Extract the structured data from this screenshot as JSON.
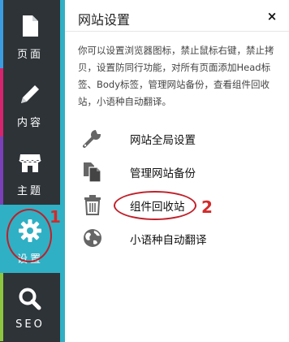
{
  "sidebar": {
    "items": [
      {
        "label": "页面",
        "icon": "page-icon",
        "accent": "#3b9de0"
      },
      {
        "label": "内容",
        "icon": "pencil-icon",
        "accent": "#d6246e"
      },
      {
        "label": "主题",
        "icon": "store-icon",
        "accent": "#7b3fb8"
      },
      {
        "label": "设置",
        "icon": "gear-icon",
        "accent": "#2fb0c4",
        "active": true
      },
      {
        "label": "SEO",
        "icon": "search-icon",
        "accent": "#8cc63f"
      }
    ]
  },
  "panel": {
    "title": "网站设置",
    "close_label": "×",
    "description": "你可以设置浏览器图标，禁止鼠标右键，禁止拷贝，设置防同行功能，对所有页面添加Head标签、Body标签，管理网站备份，查看组件回收站，小语种自动翻译。",
    "items": [
      {
        "label": "网站全局设置",
        "icon": "wrench-icon"
      },
      {
        "label": "管理网站备份",
        "icon": "copy-files-icon"
      },
      {
        "label": "组件回收站",
        "icon": "trash-icon"
      },
      {
        "label": "小语种自动翻译",
        "icon": "globe-icon"
      }
    ]
  },
  "annotations": {
    "marker_1": "1",
    "marker_2": "2",
    "color": "#c0202a"
  }
}
